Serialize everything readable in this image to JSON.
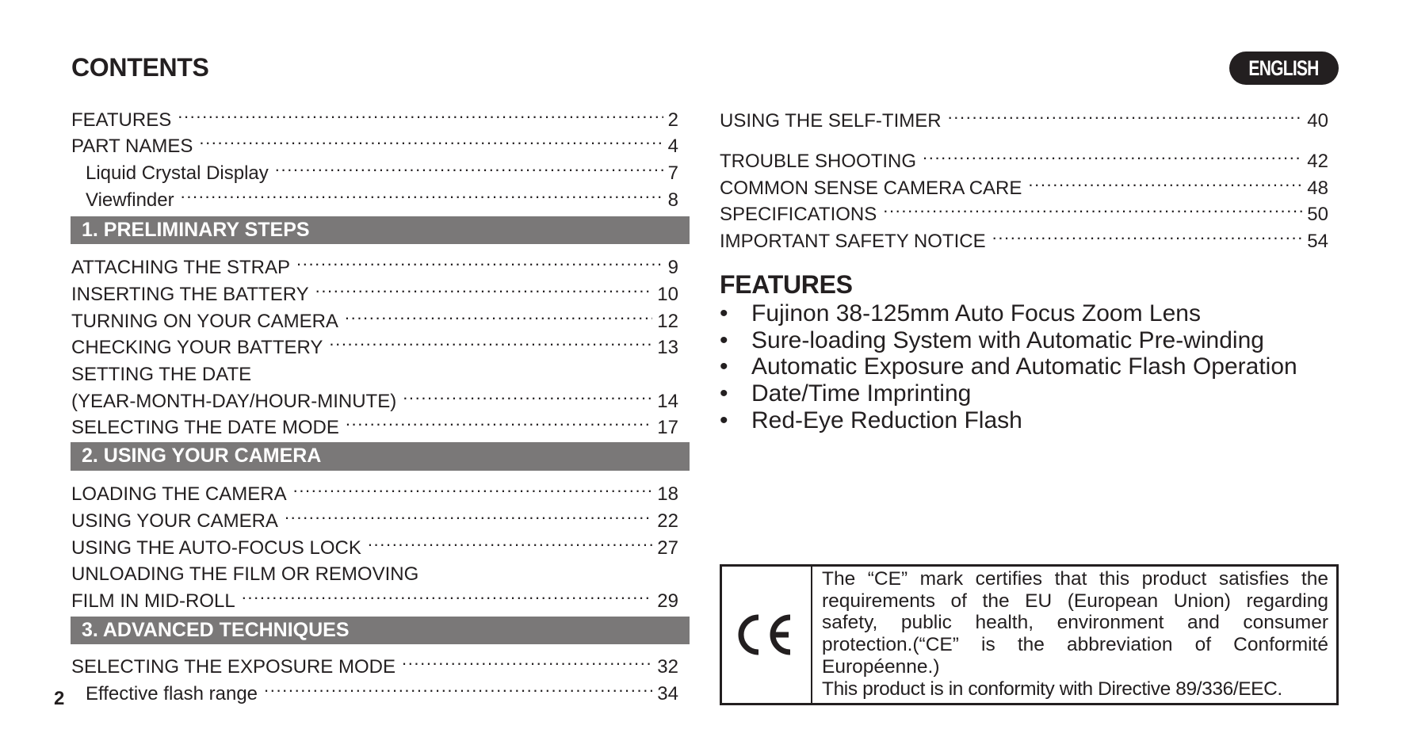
{
  "header": {
    "title": "CONTENTS",
    "language_badge": "ENGLISH"
  },
  "toc_left": {
    "intro": [
      {
        "label": "FEATURES",
        "page": "2",
        "indent": false
      },
      {
        "label": "PART NAMES",
        "page": "4",
        "indent": false
      },
      {
        "label": "Liquid Crystal Display",
        "page": "7",
        "indent": true
      },
      {
        "label": "Viewfinder",
        "page": "8",
        "indent": true
      }
    ],
    "sections": [
      {
        "heading": "1. PRELIMINARY STEPS",
        "items": [
          {
            "label": "ATTACHING THE STRAP",
            "page": "9"
          },
          {
            "label": "INSERTING THE BATTERY",
            "page": "10"
          },
          {
            "label": "TURNING ON YOUR CAMERA",
            "page": "12"
          },
          {
            "label": "CHECKING YOUR BATTERY",
            "page": "13"
          },
          {
            "label": "SETTING THE DATE",
            "page": ""
          },
          {
            "label": "(YEAR-MONTH-DAY/HOUR-MINUTE)",
            "page": "14"
          },
          {
            "label": "SELECTING THE DATE MODE",
            "page": "17"
          }
        ]
      },
      {
        "heading": "2. USING YOUR CAMERA",
        "items": [
          {
            "label": "LOADING THE CAMERA",
            "page": "18"
          },
          {
            "label": "USING YOUR CAMERA",
            "page": "22"
          },
          {
            "label": "USING THE AUTO-FOCUS LOCK",
            "page": "27"
          },
          {
            "label": "UNLOADING THE FILM OR REMOVING",
            "page": ""
          },
          {
            "label": "FILM IN MID-ROLL",
            "page": "29"
          }
        ]
      },
      {
        "heading": "3. ADVANCED TECHNIQUES",
        "items": [
          {
            "label": "SELECTING THE EXPOSURE MODE",
            "page": "32"
          },
          {
            "label": "Effective flash range",
            "page": "34"
          }
        ]
      }
    ]
  },
  "toc_right": [
    {
      "label": "USING THE SELF-TIMER",
      "page": "40"
    },
    {
      "label": "TROUBLE SHOOTING",
      "page": "42"
    },
    {
      "label": "COMMON SENSE CAMERA CARE",
      "page": "48"
    },
    {
      "label": "SPECIFICATIONS",
      "page": "50"
    },
    {
      "label": "IMPORTANT SAFETY NOTICE",
      "page": "54"
    }
  ],
  "features": {
    "heading": "FEATURES",
    "bullet": "•",
    "items": [
      "Fujinon 38-125mm Auto Focus Zoom Lens",
      "Sure-loading System with Automatic Pre-winding",
      "Automatic Exposure and Automatic Flash Operation",
      "Date/Time Imprinting",
      "Red-Eye Reduction Flash"
    ]
  },
  "ce_notice": {
    "mark_icon": "ce-mark-icon",
    "paragraph": "The “CE” mark certifies that this product satisfies the requirements of the EU (European Union) regarding safety, public health, environment and consumer protection.(“CE” is the abbreviation of Conformité Européenne.)",
    "directive": "This product is in conformity with Directive 89/336/EEC."
  },
  "footer": {
    "page_number": "2"
  },
  "colors": {
    "text": "#231f20",
    "section_bar": "#7a7878",
    "badge_bg": "#231f20"
  }
}
